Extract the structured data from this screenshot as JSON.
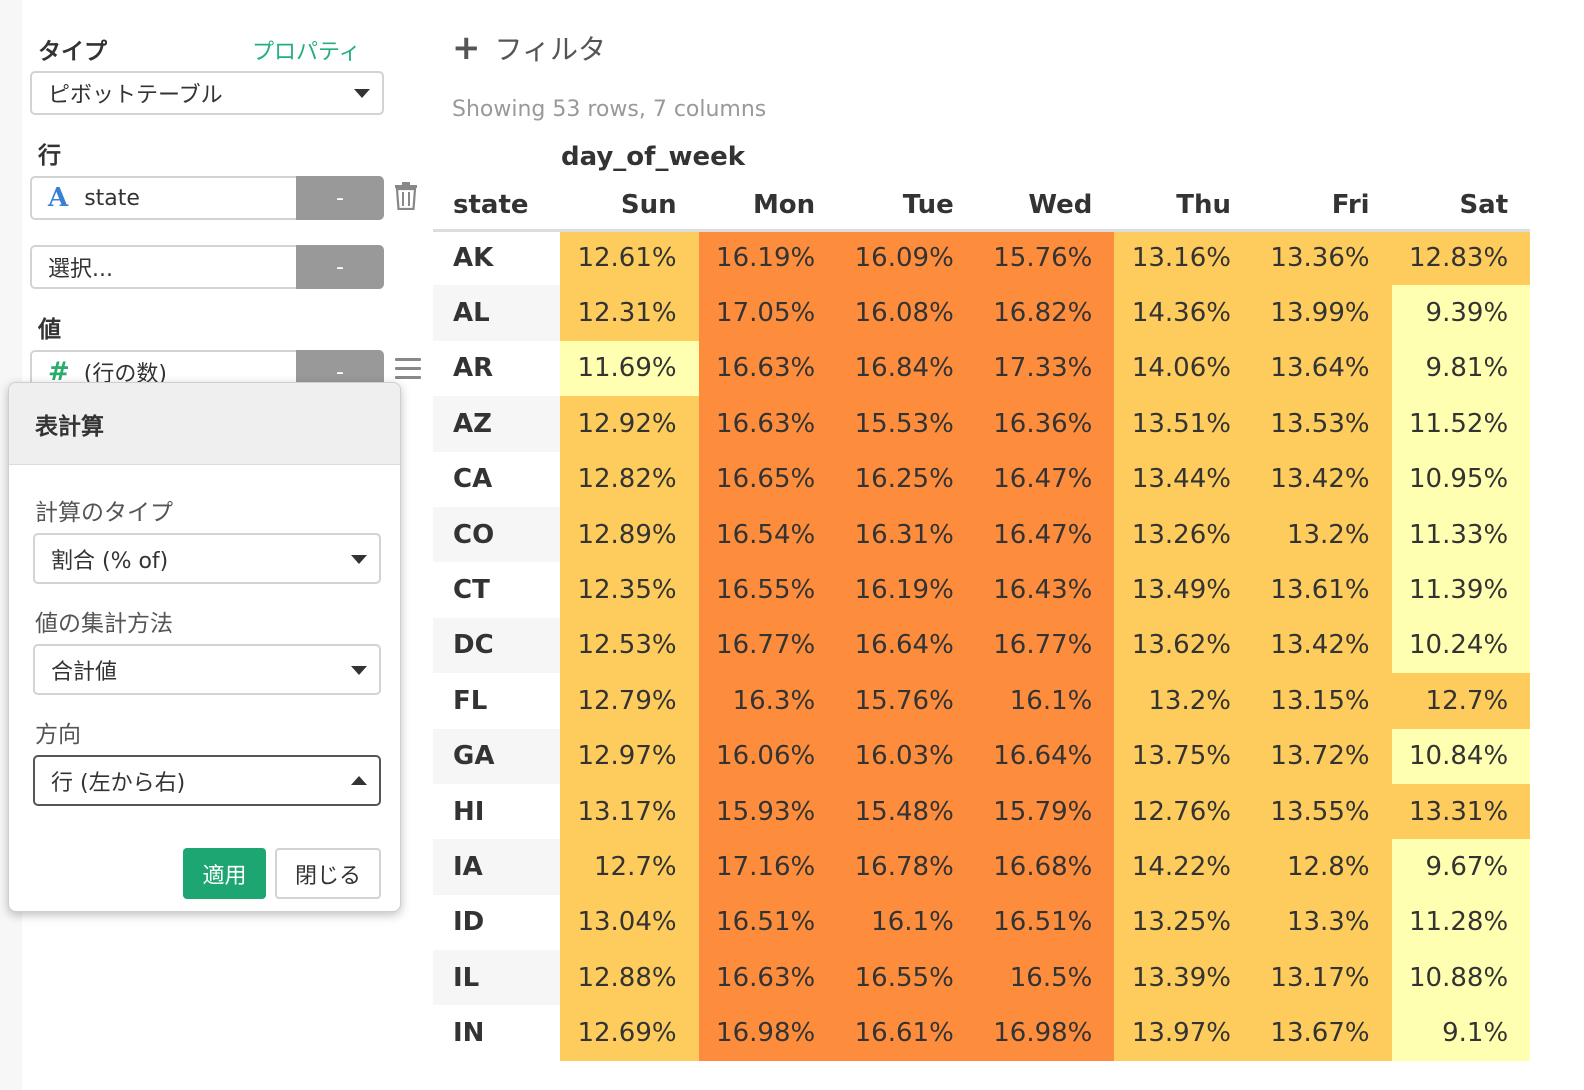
{
  "sidebar": {
    "type_label": "タイプ",
    "properties_link": "プロパティ",
    "type_value": "ピボットテーブル",
    "rows_label": "行",
    "row_field": "state",
    "row_field_type": "A",
    "row_remove": "-",
    "select_placeholder": "選択...",
    "select_remove": "-",
    "values_label": "値",
    "value_field": "(行の数)",
    "value_field_type": "#",
    "value_remove": "-"
  },
  "popup": {
    "title": "表計算",
    "calc_type_label": "計算のタイプ",
    "calc_type_value": "割合 (% of)",
    "agg_label": "値の集計方法",
    "agg_value": "合計値",
    "direction_label": "方向",
    "direction_value": "行 (左から右)",
    "apply_label": "適用",
    "close_label": "閉じる"
  },
  "toolbar": {
    "filter_label": "フィルタ",
    "showing_text": "Showing 53 rows, 7 columns"
  },
  "colors": {
    "low": "#ffffb2",
    "mid": "#fecc5c",
    "high": "#fd8d3c",
    "accent_green": "#1ea672"
  },
  "table": {
    "column_group": "day_of_week",
    "row_header": "state",
    "columns": [
      "Sun",
      "Mon",
      "Tue",
      "Wed",
      "Thu",
      "Fri",
      "Sat"
    ],
    "rows": [
      {
        "state": "AK",
        "values": [
          "12.61%",
          "16.19%",
          "16.09%",
          "15.76%",
          "13.16%",
          "13.36%",
          "12.83%"
        ],
        "levels": [
          "mid",
          "high",
          "high",
          "high",
          "mid",
          "mid",
          "mid"
        ]
      },
      {
        "state": "AL",
        "values": [
          "12.31%",
          "17.05%",
          "16.08%",
          "16.82%",
          "14.36%",
          "13.99%",
          "9.39%"
        ],
        "levels": [
          "mid",
          "high",
          "high",
          "high",
          "mid",
          "mid",
          "low"
        ]
      },
      {
        "state": "AR",
        "values": [
          "11.69%",
          "16.63%",
          "16.84%",
          "17.33%",
          "14.06%",
          "13.64%",
          "9.81%"
        ],
        "levels": [
          "low",
          "high",
          "high",
          "high",
          "mid",
          "mid",
          "low"
        ]
      },
      {
        "state": "AZ",
        "values": [
          "12.92%",
          "16.63%",
          "15.53%",
          "16.36%",
          "13.51%",
          "13.53%",
          "11.52%"
        ],
        "levels": [
          "mid",
          "high",
          "high",
          "high",
          "mid",
          "mid",
          "low"
        ]
      },
      {
        "state": "CA",
        "values": [
          "12.82%",
          "16.65%",
          "16.25%",
          "16.47%",
          "13.44%",
          "13.42%",
          "10.95%"
        ],
        "levels": [
          "mid",
          "high",
          "high",
          "high",
          "mid",
          "mid",
          "low"
        ]
      },
      {
        "state": "CO",
        "values": [
          "12.89%",
          "16.54%",
          "16.31%",
          "16.47%",
          "13.26%",
          "13.2%",
          "11.33%"
        ],
        "levels": [
          "mid",
          "high",
          "high",
          "high",
          "mid",
          "mid",
          "low"
        ]
      },
      {
        "state": "CT",
        "values": [
          "12.35%",
          "16.55%",
          "16.19%",
          "16.43%",
          "13.49%",
          "13.61%",
          "11.39%"
        ],
        "levels": [
          "mid",
          "high",
          "high",
          "high",
          "mid",
          "mid",
          "low"
        ]
      },
      {
        "state": "DC",
        "values": [
          "12.53%",
          "16.77%",
          "16.64%",
          "16.77%",
          "13.62%",
          "13.42%",
          "10.24%"
        ],
        "levels": [
          "mid",
          "high",
          "high",
          "high",
          "mid",
          "mid",
          "low"
        ]
      },
      {
        "state": "FL",
        "values": [
          "12.79%",
          "16.3%",
          "15.76%",
          "16.1%",
          "13.2%",
          "13.15%",
          "12.7%"
        ],
        "levels": [
          "mid",
          "high",
          "high",
          "high",
          "mid",
          "mid",
          "mid"
        ]
      },
      {
        "state": "GA",
        "values": [
          "12.97%",
          "16.06%",
          "16.03%",
          "16.64%",
          "13.75%",
          "13.72%",
          "10.84%"
        ],
        "levels": [
          "mid",
          "high",
          "high",
          "high",
          "mid",
          "mid",
          "low"
        ]
      },
      {
        "state": "HI",
        "values": [
          "13.17%",
          "15.93%",
          "15.48%",
          "15.79%",
          "12.76%",
          "13.55%",
          "13.31%"
        ],
        "levels": [
          "mid",
          "high",
          "high",
          "high",
          "mid",
          "mid",
          "mid"
        ]
      },
      {
        "state": "IA",
        "values": [
          "12.7%",
          "17.16%",
          "16.78%",
          "16.68%",
          "14.22%",
          "12.8%",
          "9.67%"
        ],
        "levels": [
          "mid",
          "high",
          "high",
          "high",
          "mid",
          "mid",
          "low"
        ]
      },
      {
        "state": "ID",
        "values": [
          "13.04%",
          "16.51%",
          "16.1%",
          "16.51%",
          "13.25%",
          "13.3%",
          "11.28%"
        ],
        "levels": [
          "mid",
          "high",
          "high",
          "high",
          "mid",
          "mid",
          "low"
        ]
      },
      {
        "state": "IL",
        "values": [
          "12.88%",
          "16.63%",
          "16.55%",
          "16.5%",
          "13.39%",
          "13.17%",
          "10.88%"
        ],
        "levels": [
          "mid",
          "high",
          "high",
          "high",
          "mid",
          "mid",
          "low"
        ]
      },
      {
        "state": "IN",
        "values": [
          "12.69%",
          "16.98%",
          "16.61%",
          "16.98%",
          "13.97%",
          "13.67%",
          "9.1%"
        ],
        "levels": [
          "mid",
          "high",
          "high",
          "high",
          "mid",
          "mid",
          "low"
        ]
      }
    ]
  }
}
